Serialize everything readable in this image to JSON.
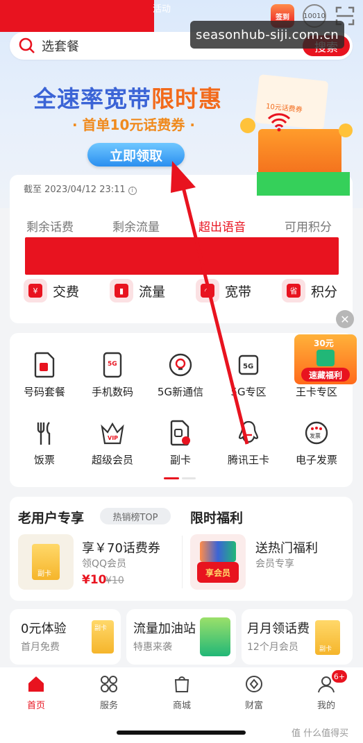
{
  "status": {
    "top_left_text": "活动"
  },
  "top_icons": {
    "checkin": "签到",
    "service": "10010",
    "scan": "scan-icon"
  },
  "watermark": "seasonhub-siji.com.cn",
  "search": {
    "placeholder": "选套餐",
    "button": "搜索"
  },
  "banner": {
    "title_blue": "全速率宽带",
    "title_orange": "限时惠",
    "subtitle": "· 首单10元话费券 ·",
    "button": "立即领取",
    "card_text": "10元话费券"
  },
  "account": {
    "as_of": "截至 2023/04/12 23:11",
    "tabs": [
      "剩余话费",
      "剩余流量",
      "超出语音",
      "可用积分"
    ],
    "active_tab": 2,
    "quick_actions": [
      {
        "icon": "yen-icon",
        "glyph": "¥",
        "label": "交费"
      },
      {
        "icon": "bar-chart-icon",
        "glyph": "▮",
        "label": "流量"
      },
      {
        "icon": "broadband-icon",
        "glyph": "◠",
        "label": "宽带"
      },
      {
        "icon": "province-icon",
        "glyph": "省",
        "label": "积分"
      }
    ]
  },
  "services": {
    "row1": [
      {
        "icon": "sim-package-icon",
        "glyph": "◧",
        "label": "号码套餐"
      },
      {
        "icon": "phone-digital-icon",
        "glyph": "5G",
        "label": "手机数码"
      },
      {
        "icon": "5g-new-call-icon",
        "glyph": "◉",
        "label": "5G新通信"
      },
      {
        "icon": "5g-zone-icon",
        "glyph": "5G",
        "label": "5G专区"
      },
      {
        "icon": "king-card-zone-icon",
        "glyph": "",
        "label": "王卡专区"
      }
    ],
    "row2": [
      {
        "icon": "fork-knife-icon",
        "glyph": "Ψ",
        "label": "饭票"
      },
      {
        "icon": "vip-crown-icon",
        "glyph": "VIP",
        "label": "超级会员"
      },
      {
        "icon": "sub-card-icon",
        "glyph": "副",
        "label": "副卡"
      },
      {
        "icon": "qq-penguin-icon",
        "glyph": "◓",
        "label": "腾讯王卡"
      },
      {
        "icon": "e-invoice-icon",
        "glyph": "发票",
        "label": "电子发票"
      }
    ],
    "promo": {
      "top": "30元",
      "bottom": "速藏福利"
    }
  },
  "old_user": {
    "title": "老用户专享",
    "badge": "热销榜TOP",
    "item": {
      "title": "享￥70话费券",
      "sub": "领QQ会员",
      "price": "¥10",
      "old_price": "¥10",
      "thumb_text": "副卡"
    }
  },
  "limited": {
    "title": "限时福利",
    "item": {
      "title": "送热门福利",
      "sub": "会员专享",
      "thumb_text": "享会员"
    }
  },
  "bottom_cards": [
    {
      "title": "0元体验",
      "sub": "首月免费",
      "thumb_text": "副卡"
    },
    {
      "title": "流量加油站",
      "sub": "特惠来袭",
      "thumb_text": ""
    },
    {
      "title": "月月领话费",
      "sub": "12个月会员",
      "thumb_text": "副卡"
    }
  ],
  "nav": [
    {
      "icon": "home-icon",
      "label": "首页"
    },
    {
      "icon": "services-grid-icon",
      "label": "服务"
    },
    {
      "icon": "shopping-bag-icon",
      "label": "商城"
    },
    {
      "icon": "wealth-icon",
      "label": "财富"
    },
    {
      "icon": "profile-icon",
      "label": "我的"
    }
  ],
  "nav_badge": "6+",
  "footer_mark": "值 什么值得买",
  "colors": {
    "accent": "#e8131f",
    "blue": "#3b64d6",
    "orange": "#f26a1b"
  }
}
